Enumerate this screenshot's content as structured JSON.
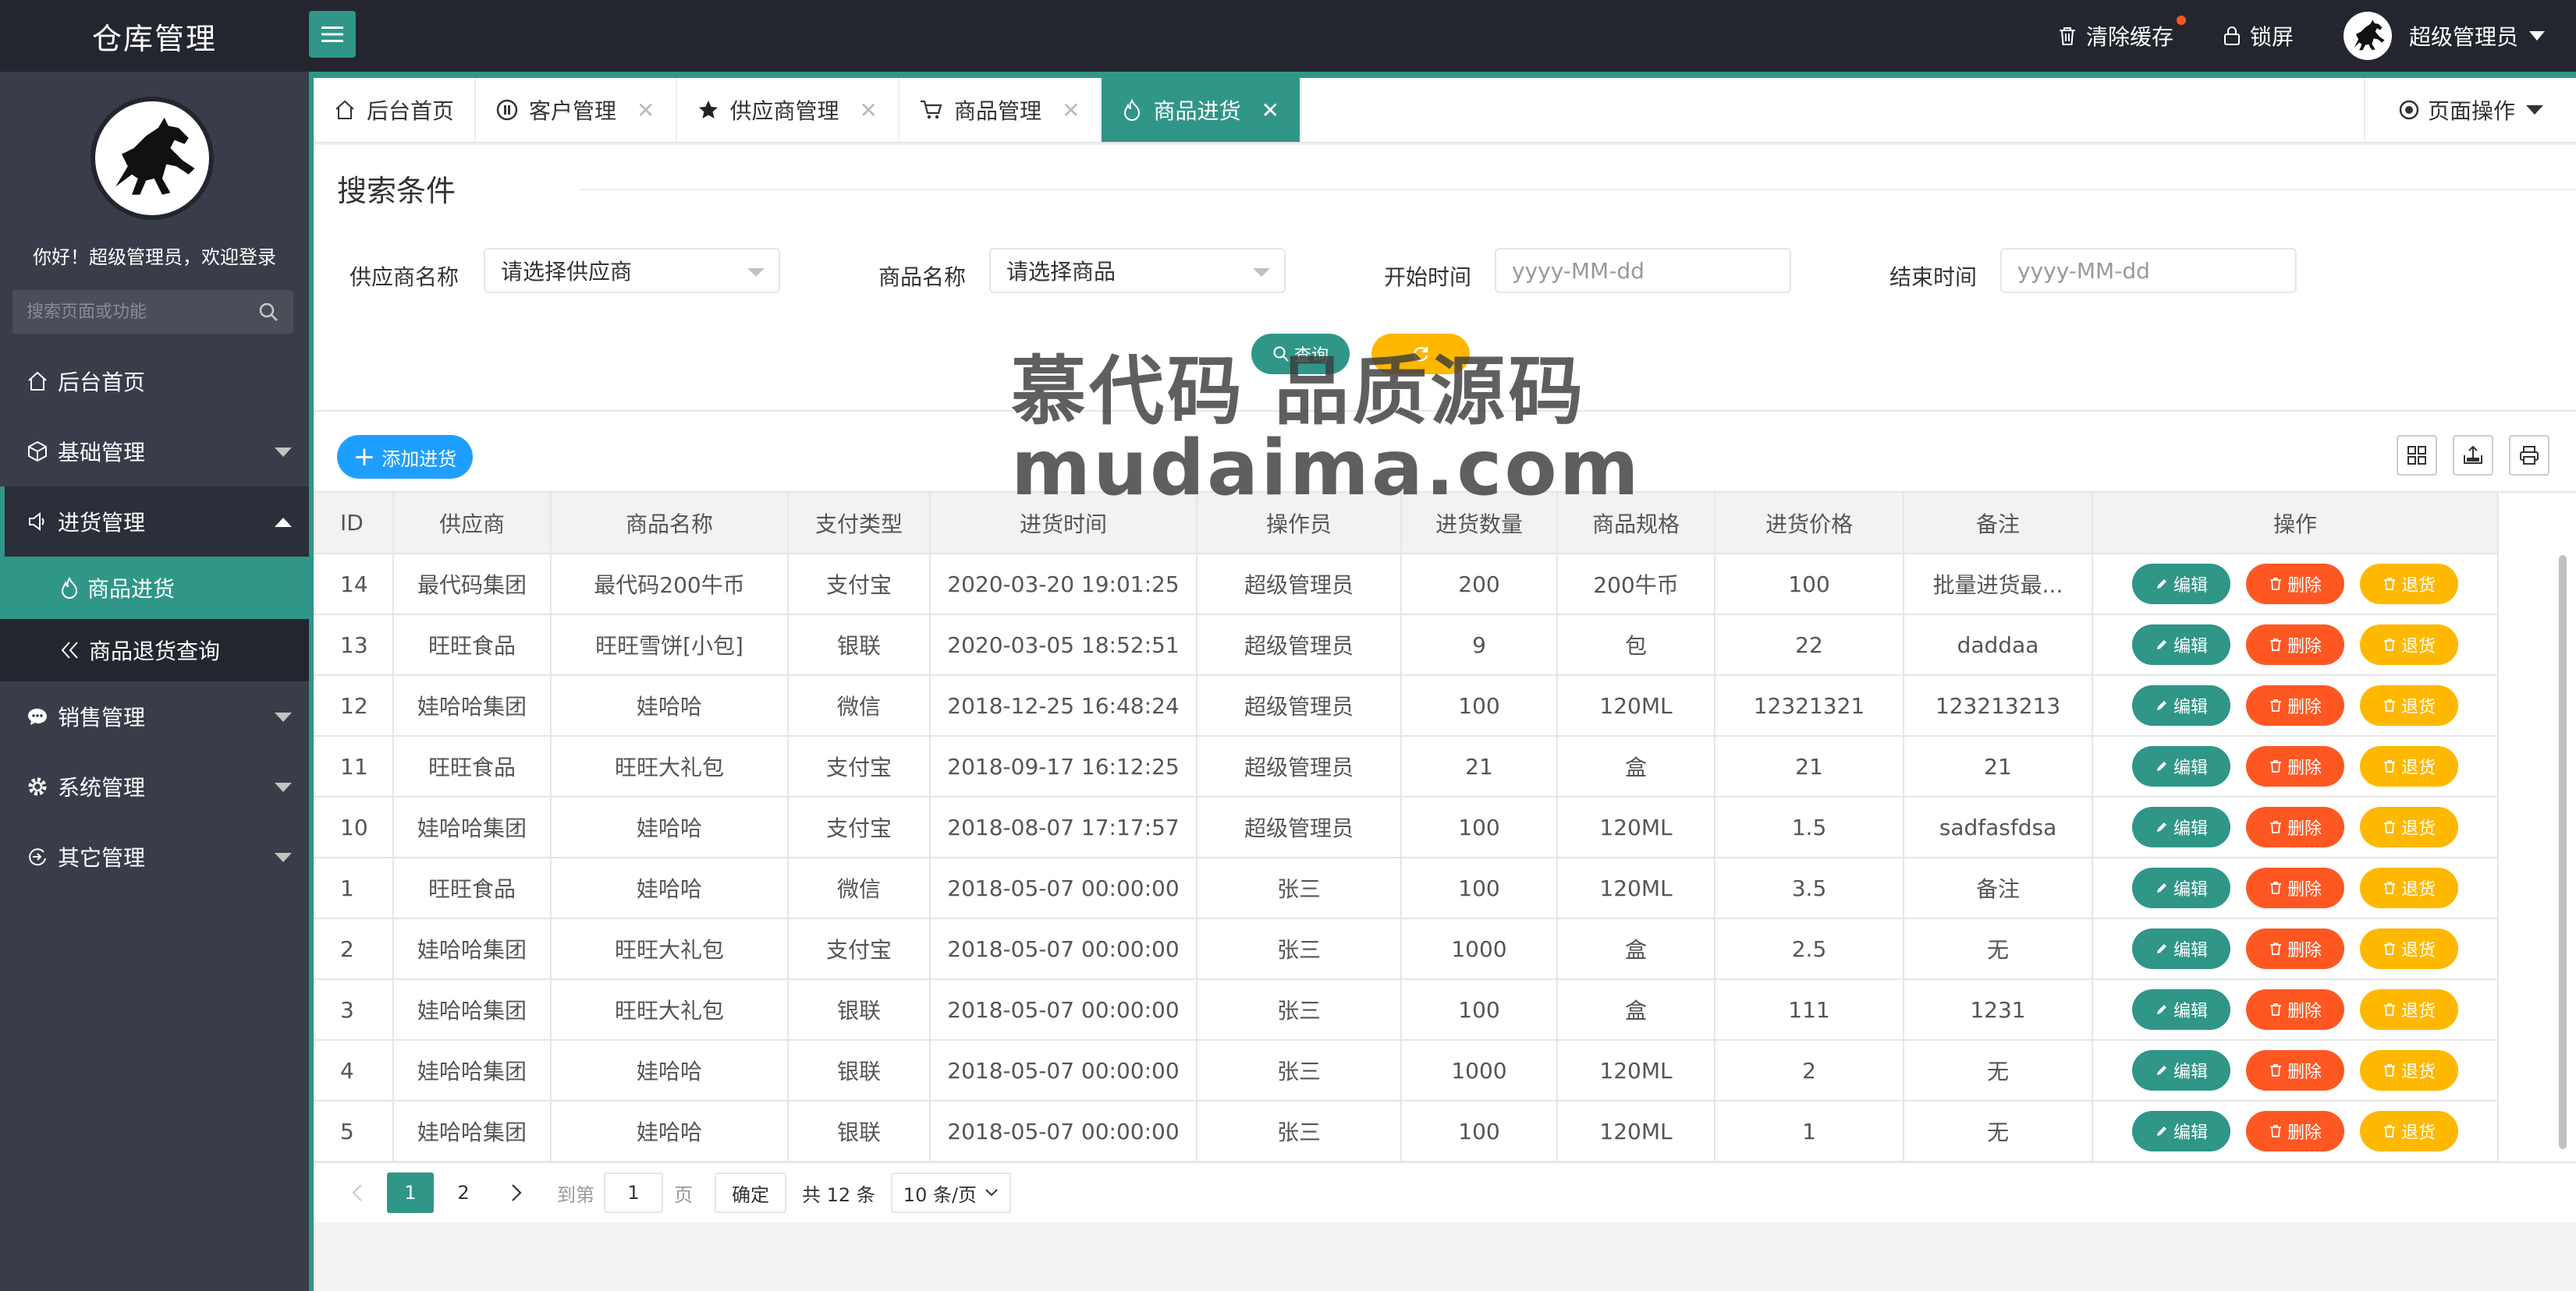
{
  "app": {
    "title": "仓库管理",
    "accent": "#2f9688",
    "header_bg": "#23262e",
    "sidebar_bg": "#393d49"
  },
  "header": {
    "clear_cache": "清除缓存",
    "lock_screen": "锁屏",
    "user_name": "超级管理员"
  },
  "sidebar": {
    "welcome": "你好！超级管理员，欢迎登录",
    "search_placeholder": "搜索页面或功能",
    "items": [
      {
        "label": "后台首页",
        "icon": "home-icon"
      },
      {
        "label": "基础管理",
        "icon": "cube-icon"
      },
      {
        "label": "进货管理",
        "icon": "speaker-icon"
      },
      {
        "label": "销售管理",
        "icon": "chat-icon"
      },
      {
        "label": "系统管理",
        "icon": "gear-icon"
      },
      {
        "label": "其它管理",
        "icon": "circle-arrow-icon"
      }
    ],
    "sub_items": [
      {
        "label": "商品进货",
        "icon": "fire-icon",
        "active": true
      },
      {
        "label": "商品退货查询",
        "icon": "double-chevron-left-icon",
        "active": false
      }
    ]
  },
  "tabs": [
    {
      "label": "后台首页",
      "icon": "home-icon",
      "closable": false
    },
    {
      "label": "客户管理",
      "icon": "pause-circle-icon",
      "closable": true
    },
    {
      "label": "供应商管理",
      "icon": "star-icon",
      "closable": true
    },
    {
      "label": "商品管理",
      "icon": "cart-icon",
      "closable": true
    },
    {
      "label": "商品进货",
      "icon": "fire-icon",
      "closable": true,
      "active": true
    }
  ],
  "page_ops": "页面操作",
  "search": {
    "legend": "搜索条件",
    "supplier_label": "供应商名称",
    "supplier_value": "请选择供应商",
    "goods_label": "商品名称",
    "goods_value": "请选择商品",
    "start_label": "开始时间",
    "start_placeholder": "yyyy-MM-dd",
    "end_label": "结束时间",
    "end_placeholder": "yyyy-MM-dd",
    "query_label": "查询"
  },
  "watermark": {
    "line1": "慕代码 品质源码",
    "line2": "mudaima.com"
  },
  "toolbar": {
    "add_label": "添加进货"
  },
  "table": {
    "columns": [
      "ID",
      "供应商",
      "商品名称",
      "支付类型",
      "进货时间",
      "操作员",
      "进货数量",
      "商品规格",
      "进货价格",
      "备注",
      "操作"
    ],
    "actions": {
      "edit": "编辑",
      "delete": "删除",
      "return": "退货"
    },
    "rows": [
      {
        "id": "14",
        "supplier": "最代码集团",
        "goods": "最代码200牛币",
        "pay": "支付宝",
        "time": "2020-03-20 19:01:25",
        "operator": "超级管理员",
        "qty": "200",
        "spec": "200牛币",
        "price": "100",
        "remark": "批量进货最..."
      },
      {
        "id": "13",
        "supplier": "旺旺食品",
        "goods": "旺旺雪饼[小包]",
        "pay": "银联",
        "time": "2020-03-05 18:52:51",
        "operator": "超级管理员",
        "qty": "9",
        "spec": "包",
        "price": "22",
        "remark": "daddaa"
      },
      {
        "id": "12",
        "supplier": "娃哈哈集团",
        "goods": "娃哈哈",
        "pay": "微信",
        "time": "2018-12-25 16:48:24",
        "operator": "超级管理员",
        "qty": "100",
        "spec": "120ML",
        "price": "12321321",
        "remark": "123213213"
      },
      {
        "id": "11",
        "supplier": "旺旺食品",
        "goods": "旺旺大礼包",
        "pay": "支付宝",
        "time": "2018-09-17 16:12:25",
        "operator": "超级管理员",
        "qty": "21",
        "spec": "盒",
        "price": "21",
        "remark": "21"
      },
      {
        "id": "10",
        "supplier": "娃哈哈集团",
        "goods": "娃哈哈",
        "pay": "支付宝",
        "time": "2018-08-07 17:17:57",
        "operator": "超级管理员",
        "qty": "100",
        "spec": "120ML",
        "price": "1.5",
        "remark": "sadfasfdsa"
      },
      {
        "id": "1",
        "supplier": "旺旺食品",
        "goods": "娃哈哈",
        "pay": "微信",
        "time": "2018-05-07 00:00:00",
        "operator": "张三",
        "qty": "100",
        "spec": "120ML",
        "price": "3.5",
        "remark": "备注"
      },
      {
        "id": "2",
        "supplier": "娃哈哈集团",
        "goods": "旺旺大礼包",
        "pay": "支付宝",
        "time": "2018-05-07 00:00:00",
        "operator": "张三",
        "qty": "1000",
        "spec": "盒",
        "price": "2.5",
        "remark": "无"
      },
      {
        "id": "3",
        "supplier": "娃哈哈集团",
        "goods": "旺旺大礼包",
        "pay": "银联",
        "time": "2018-05-07 00:00:00",
        "operator": "张三",
        "qty": "100",
        "spec": "盒",
        "price": "111",
        "remark": "1231"
      },
      {
        "id": "4",
        "supplier": "娃哈哈集团",
        "goods": "娃哈哈",
        "pay": "银联",
        "time": "2018-05-07 00:00:00",
        "operator": "张三",
        "qty": "1000",
        "spec": "120ML",
        "price": "2",
        "remark": "无"
      },
      {
        "id": "5",
        "supplier": "娃哈哈集团",
        "goods": "娃哈哈",
        "pay": "银联",
        "time": "2018-05-07 00:00:00",
        "operator": "张三",
        "qty": "100",
        "spec": "120ML",
        "price": "1",
        "remark": "无"
      }
    ]
  },
  "pagination": {
    "pages": [
      "1",
      "2"
    ],
    "current": "1",
    "goto_label": "到第",
    "goto_value": "1",
    "page_unit": "页",
    "confirm": "确定",
    "total": "共 12 条",
    "limit": "10 条/页"
  }
}
